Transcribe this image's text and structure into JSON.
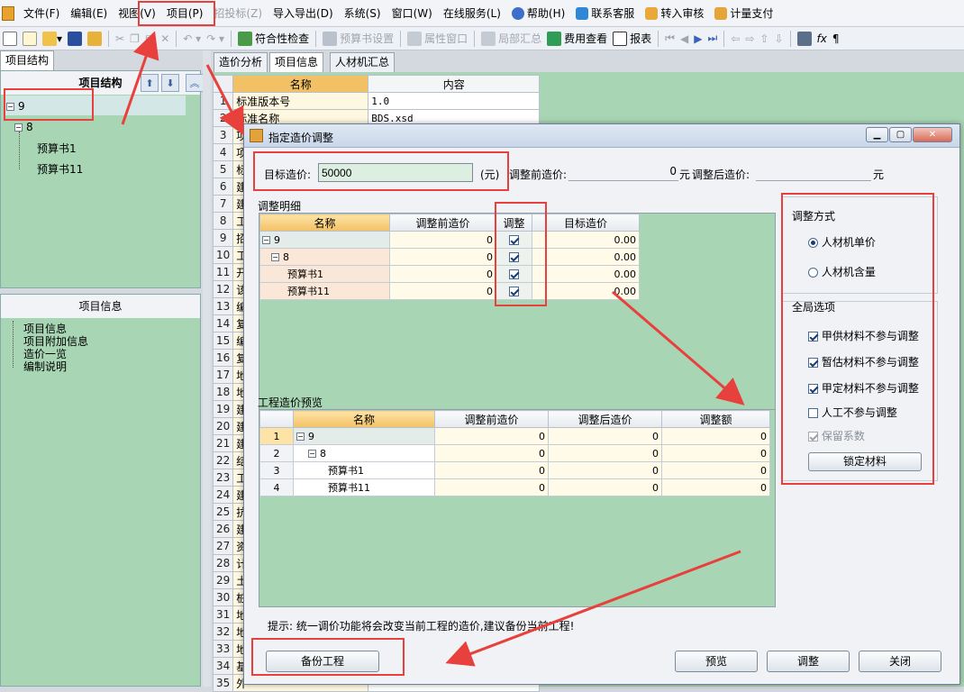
{
  "menu": {
    "items": [
      "文件(F)",
      "编辑(E)",
      "视图(V)",
      "项目(P)",
      "招投标(Z)",
      "导入导出(D)",
      "系统(S)",
      "窗口(W)",
      "在线服务(L)",
      "帮助(H)",
      "联系客服",
      "转入审核",
      "计量支付"
    ]
  },
  "toolbar": {
    "compliance": "符合性检查",
    "budget_settings": "预算书设置",
    "property_window": "属性窗口",
    "local_summary": "局部汇总",
    "cost_view": "费用查看",
    "report": "报表"
  },
  "left": {
    "tab": "项目结构",
    "header": "项目结构",
    "tree": [
      "9",
      "8",
      "预算书1",
      "预算书11"
    ],
    "info_header": "项目信息",
    "info_items": [
      "项目信息",
      "项目附加信息",
      "造价一览",
      "编制说明"
    ]
  },
  "main": {
    "tabs": [
      "造价分析",
      "项目信息",
      "人材机汇总"
    ],
    "col_name": "名称",
    "col_content": "内容",
    "rows": [
      {
        "no": "1",
        "name": "标准版本号",
        "content": "1.0"
      },
      {
        "no": "2",
        "name": "标准名称",
        "content": "BDS.xsd"
      },
      {
        "no": "3",
        "name": "项"
      },
      {
        "no": "4",
        "name": "项"
      },
      {
        "no": "5",
        "name": "标"
      },
      {
        "no": "6",
        "name": "建"
      },
      {
        "no": "7",
        "name": "建"
      },
      {
        "no": "8",
        "name": "工"
      },
      {
        "no": "9",
        "name": "招"
      },
      {
        "no": "10",
        "name": "工"
      },
      {
        "no": "11",
        "name": "开"
      },
      {
        "no": "12",
        "name": "该"
      },
      {
        "no": "13",
        "name": "编"
      },
      {
        "no": "14",
        "name": "复"
      },
      {
        "no": "15",
        "name": "编"
      },
      {
        "no": "16",
        "name": "复"
      },
      {
        "no": "17",
        "name": "地"
      },
      {
        "no": "18",
        "name": "地"
      },
      {
        "no": "19",
        "name": "建"
      },
      {
        "no": "20",
        "name": "建"
      },
      {
        "no": "21",
        "name": "建"
      },
      {
        "no": "22",
        "name": "结"
      },
      {
        "no": "23",
        "name": "工"
      },
      {
        "no": "24",
        "name": "建"
      },
      {
        "no": "25",
        "name": "抗"
      },
      {
        "no": "26",
        "name": "建"
      },
      {
        "no": "27",
        "name": "资"
      },
      {
        "no": "28",
        "name": "计"
      },
      {
        "no": "29",
        "name": "土"
      },
      {
        "no": "30",
        "name": "桩"
      },
      {
        "no": "31",
        "name": "地"
      },
      {
        "no": "32",
        "name": "地"
      },
      {
        "no": "33",
        "name": "地"
      },
      {
        "no": "34",
        "name": "基"
      },
      {
        "no": "35",
        "name": "外"
      }
    ]
  },
  "dialog": {
    "title": "指定造价调整",
    "target_label": "目标造价:",
    "target_value": "50000",
    "unit": "(元)",
    "pre_label": "调整前造价:",
    "pre_value": "0",
    "pre_unit": "元",
    "post_label": "调整后造价:",
    "post_unit": "元",
    "detail_title": "调整明细",
    "detail_headers": [
      "名称",
      "调整前造价",
      "调整",
      "目标造价"
    ],
    "detail_rows": [
      {
        "name": "9",
        "pre": "0",
        "target": "0.00"
      },
      {
        "name": "8",
        "pre": "0",
        "target": "0.00"
      },
      {
        "name": "预算书1",
        "pre": "0",
        "target": "0.00"
      },
      {
        "name": "预算书11",
        "pre": "0",
        "target": "0.00"
      }
    ],
    "preview_title": "工程造价预览",
    "preview_headers": [
      "名称",
      "调整前造价",
      "调整后造价",
      "调整额"
    ],
    "preview_rows": [
      {
        "no": "1",
        "name": "9",
        "pre": "0",
        "post": "0",
        "diff": "0"
      },
      {
        "no": "2",
        "name": "8",
        "pre": "0",
        "post": "0",
        "diff": "0"
      },
      {
        "no": "3",
        "name": "预算书1",
        "pre": "0",
        "post": "0",
        "diff": "0"
      },
      {
        "no": "4",
        "name": "预算书11",
        "pre": "0",
        "post": "0",
        "diff": "0"
      }
    ],
    "method_title": "调整方式",
    "method_options": [
      "人材机单价",
      "人材机含量"
    ],
    "global_title": "全局选项",
    "global_options": [
      "甲供材料不参与调整",
      "暂估材料不参与调整",
      "甲定材料不参与调整",
      "人工不参与调整",
      "保留系数"
    ],
    "lock_button": "锁定材料",
    "hint": "提示: 统一调价功能将会改变当前工程的造价,建议备份当前工程!",
    "backup_button": "备份工程",
    "preview_button": "预览",
    "adjust_button": "调整",
    "close_button": "关闭"
  },
  "colors": {
    "grid_bg": "#a8d5b4",
    "annotation_red": "#e8403c",
    "header_orange": "#f3c165"
  }
}
